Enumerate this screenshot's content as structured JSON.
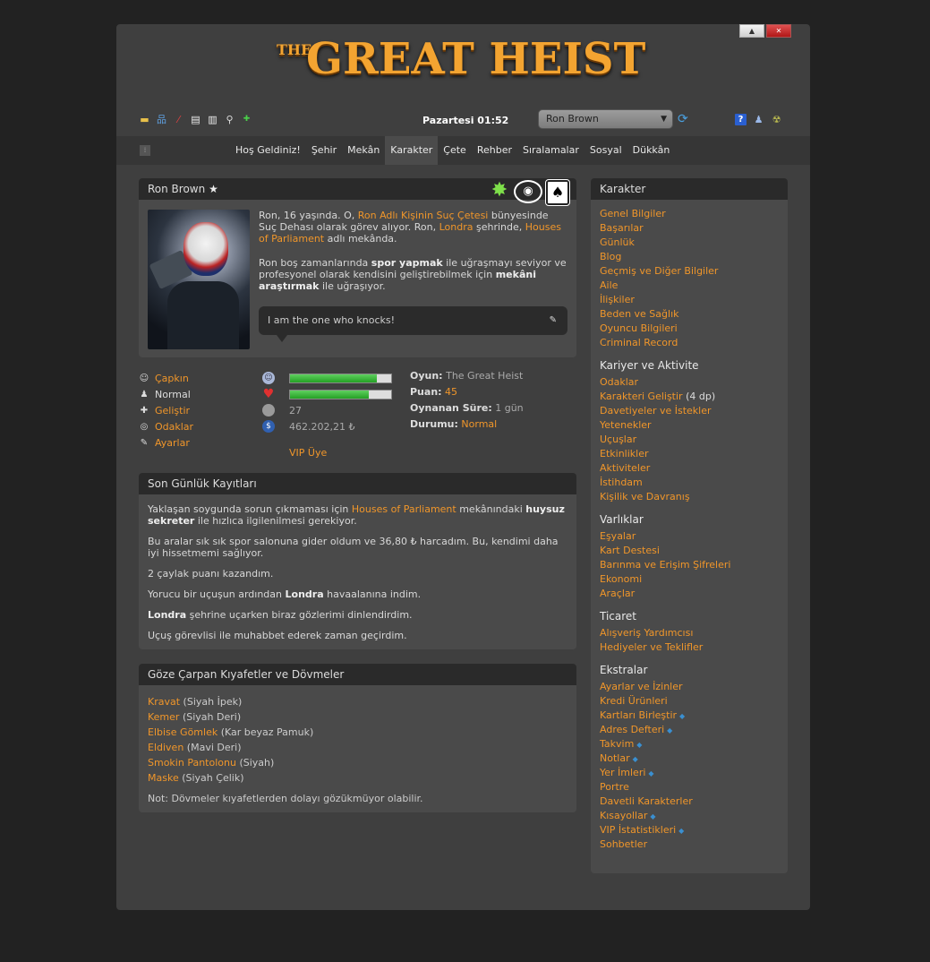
{
  "window": {
    "minimize_label": "▲",
    "close_label": "✕"
  },
  "logo": {
    "the": "THE",
    "main": "GREAT HEIST"
  },
  "toolbar": {
    "icons": [
      "pencil-bar-icon",
      "sitemap-icon",
      "red-pen-icon",
      "document-icon",
      "book-icon",
      "search-icon",
      "plus-icon"
    ],
    "date": "Pazartesi 01:52",
    "character": "Ron Brown",
    "right_icons": [
      "help-icon",
      "user-icon",
      "radiation-icon"
    ]
  },
  "nav": {
    "items": [
      "Hoş Geldiniz!",
      "Şehir",
      "Mekân",
      "Karakter",
      "Çete",
      "Rehber",
      "Sıralamalar",
      "Sosyal",
      "Dükkân"
    ],
    "active": "Karakter"
  },
  "profile": {
    "name": "Ron Brown",
    "bio_1a": "Ron, 16 yaşında. O, ",
    "bio_1_link1": "Ron Adlı Kişinin Suç Çetesi",
    "bio_1b": " bünyesinde Suç Dehası olarak görev alıyor. Ron, ",
    "bio_1_link2": "Londra",
    "bio_1c": " şehrinde, ",
    "bio_1_link3": "Houses of Parliament",
    "bio_1d": " adlı mekânda.",
    "bio_2a": "Ron boş zamanlarında ",
    "bio_2_b1": "spor yapmak",
    "bio_2b": " ile uğraşmayı seviyor ve profesyonel olarak kendisini geliştirebilmek için ",
    "bio_2_b2": "mekâni araştırmak",
    "bio_2c": " ile uğraşıyor.",
    "quote": "I am the one who knocks!"
  },
  "actions": [
    {
      "icon": "mood-icon",
      "label": "Çapkın",
      "link": true
    },
    {
      "icon": "person-icon",
      "label": "Normal",
      "link": false
    },
    {
      "icon": "plus-icon",
      "label": "Geliştir",
      "link": true
    },
    {
      "icon": "eye-icon",
      "label": "Odaklar",
      "link": true
    },
    {
      "icon": "wrench-icon",
      "label": "Ayarlar",
      "link": true
    }
  ],
  "stats": {
    "happiness": 0.86,
    "health": 0.78,
    "level": "27",
    "money": "462.202,21 ₺",
    "vip": "VIP Üye"
  },
  "gameinfo": {
    "game_k": "Oyun:",
    "game_v": "The Great Heist",
    "points_k": "Puan:",
    "points_v": "45",
    "played_k": "Oynanan Süre:",
    "played_v": "1 gün",
    "status_k": "Durumu:",
    "status_v": "Normal"
  },
  "log": {
    "title": "Son Günlük Kayıtları",
    "e1a": "Yaklaşan soygunda sorun çıkmaması için ",
    "e1_link": "Houses of Parliament",
    "e1b": " mekânındaki ",
    "e1_bold": "huysuz sekreter",
    "e1c": " ile hızlıca ilgilenilmesi gerekiyor.",
    "e2": "Bu aralar sık sık spor salonuna gider oldum ve 36,80 ₺ harcadım. Bu, kendimi daha iyi hissetmemi sağlıyor.",
    "e3": "2 çaylak puanı kazandım.",
    "e4a": "Yorucu bir uçuşun ardından ",
    "e4_bold": "Londra",
    "e4b": " havaalanına indim.",
    "e5_bold": "Londra",
    "e5b": " şehrine uçarken biraz gözlerimi dinlendirdim.",
    "e6": "Uçuş görevlisi ile muhabbet ederek zaman geçirdim."
  },
  "outfit": {
    "title": "Göze Çarpan Kıyafetler ve Dövmeler",
    "items": [
      {
        "name": "Kravat",
        "detail": " (Siyah İpek)"
      },
      {
        "name": "Kemer",
        "detail": " (Siyah Deri)"
      },
      {
        "name": "Elbise Gömlek",
        "detail": " (Kar beyaz Pamuk)"
      },
      {
        "name": "Eldiven",
        "detail": " (Mavi Deri)"
      },
      {
        "name": "Smokin Pantolonu",
        "detail": " (Siyah)"
      },
      {
        "name": "Maske",
        "detail": " (Siyah Çelik)"
      }
    ],
    "note": "Not: Dövmeler kıyafetlerden dolayı gözükmüyor olabilir."
  },
  "sidebar": {
    "title": "Karakter",
    "group1": [
      "Genel Bilgiler",
      "Başarılar",
      "Günlük",
      "Blog",
      "Geçmiş ve Diğer Bilgiler",
      "Aile",
      "İlişkiler",
      "Beden ve Sağlık",
      "Oyuncu Bilgileri",
      "Criminal Record"
    ],
    "career_title": "Kariyer ve Aktivite",
    "career": [
      "Odaklar",
      "Karakteri Geliştir",
      "Davetiyeler ve İstekler",
      "Yetenekler",
      "Uçuşlar",
      "Etkinlikler",
      "Aktiviteler",
      "İstihdam",
      "Kişilik ve Davranış"
    ],
    "career_extra": " (4 dp)",
    "assets_title": "Varlıklar",
    "assets": [
      "Eşyalar",
      "Kart Destesi",
      "Barınma ve Erişim Şifreleri",
      "Ekonomi",
      "Araçlar"
    ],
    "trade_title": "Ticaret",
    "trade": [
      "Alışveriş Yardımcısı",
      "Hediyeler ve Teklifler"
    ],
    "extras_title": "Ekstralar",
    "extras": [
      "Ayarlar ve İzinler",
      "Kredi Ürünleri",
      "Kartları Birleştir",
      "Adres Defteri",
      "Takvim",
      "Notlar",
      "Yer İmleri",
      "Portre",
      "Davetli Karakterler",
      "Kısayollar",
      "VIP İstatistikleri",
      "Sohbetler"
    ]
  }
}
